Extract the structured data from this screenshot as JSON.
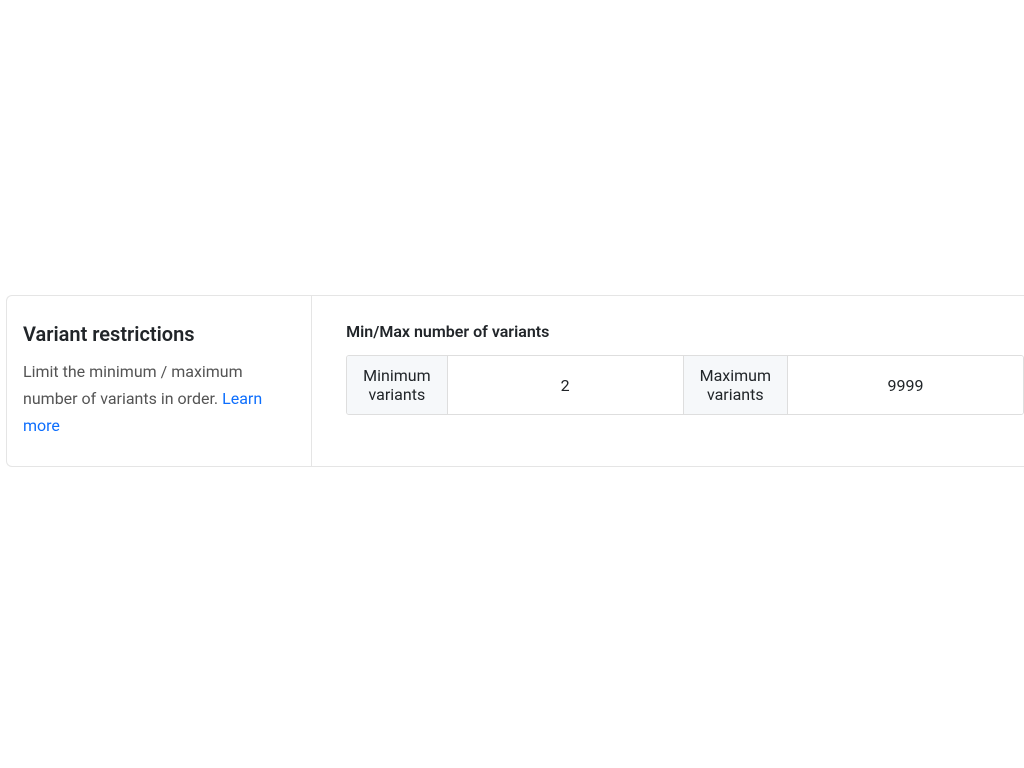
{
  "section": {
    "title": "Variant restrictions",
    "description_prefix": "Limit the minimum / maximum number of variants in order. ",
    "learn_more_label": "Learn more"
  },
  "panel": {
    "title": "Min/Max number of variants",
    "min_label": "Minimum variants",
    "min_value": "2",
    "max_label": "Maximum variants",
    "max_value": "9999"
  }
}
